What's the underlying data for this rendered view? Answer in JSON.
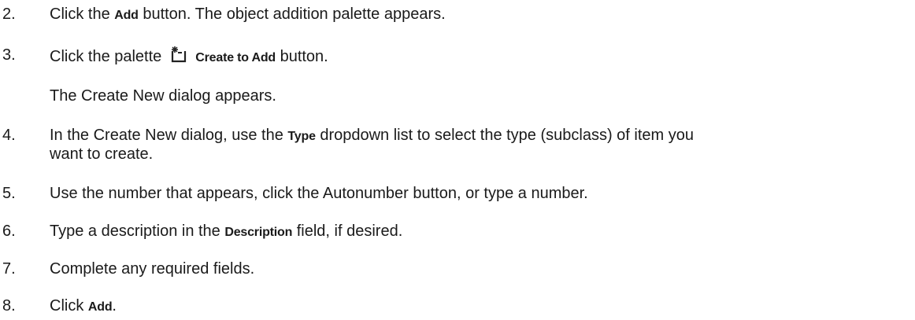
{
  "steps": [
    {
      "number": "2.",
      "pre": "Click the ",
      "ui": "Add",
      "post": " button. The object addition palette appears."
    },
    {
      "number": "3.",
      "pre": "Click the palette",
      "icon": "create-new-icon",
      "ui": "Create to Add",
      "post": " button.",
      "note": "The Create New dialog appears."
    },
    {
      "number": "4.",
      "pre": "In the Create New dialog, use the ",
      "ui": "Type",
      "post1": " dropdown list to select the type (subclass) of item you",
      "post2": "want to create."
    },
    {
      "number": "5.",
      "text": "Use the number that appears, click the Autonumber button, or type a number."
    },
    {
      "number": "6.",
      "pre": "Type a description in the ",
      "ui": "Description",
      "post": " field, if desired."
    },
    {
      "number": "7.",
      "text": "Complete any required fields."
    },
    {
      "number": "8.",
      "pre": "Click ",
      "ui": "Add",
      "post": "."
    }
  ]
}
